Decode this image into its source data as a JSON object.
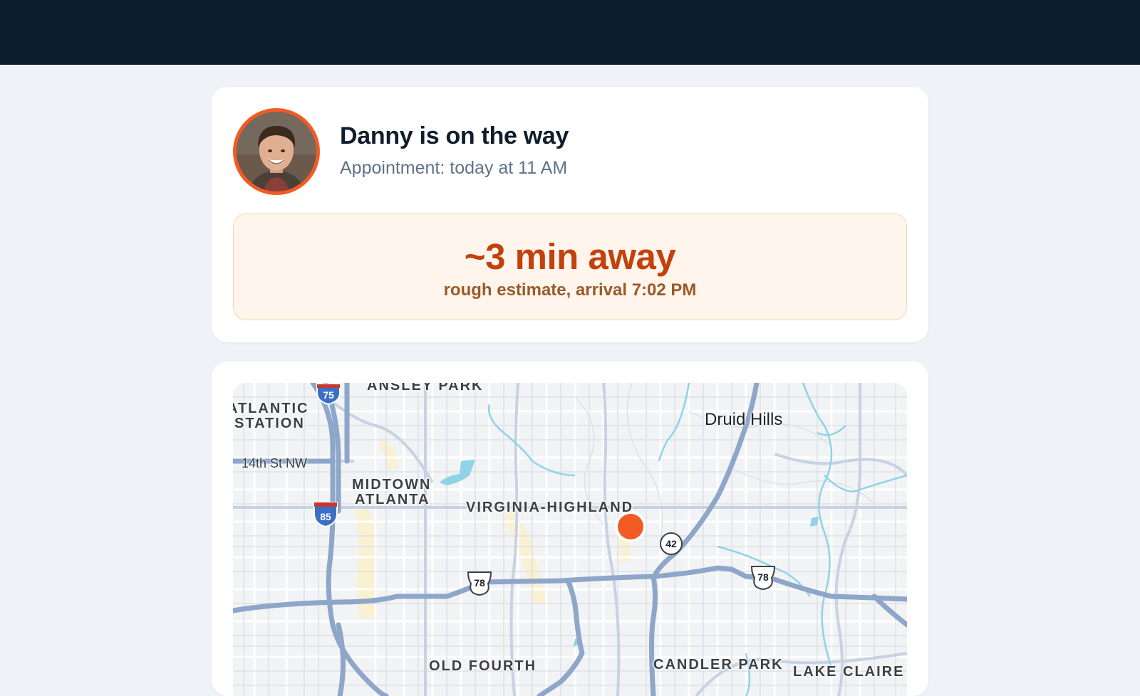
{
  "header": {},
  "tech": {
    "avatar": "technician-photo",
    "title": "Danny is on the way",
    "appointment": "Appointment: today at 11 AM"
  },
  "eta": {
    "main": "~3 min away",
    "sub": "rough estimate, arrival 7:02 PM"
  },
  "map": {
    "labels": {
      "ansley_park": "ANSLEY PARK",
      "atlantic_1": "ATLANTIC",
      "atlantic_2": "STATION",
      "midtown_1": "MIDTOWN",
      "midtown_2": "ATLANTA",
      "virginia_highland": "VIRGINIA-HIGHLAND",
      "druid_hills": "Druid Hills",
      "fourteenth": "14th St NW",
      "old_fourth": "OLD FOURTH",
      "candler_park": "CANDLER PARK",
      "lake_claire": "LAKE CLAIRE"
    },
    "shields": {
      "i75": "75",
      "i85": "85",
      "us78_a": "78",
      "us78_b": "78",
      "sr42": "42"
    },
    "marker_color": "#f25b24"
  },
  "colors": {
    "topbar": "#0c1e2b",
    "accent": "#f25b24",
    "eta_text": "#c2410c"
  }
}
